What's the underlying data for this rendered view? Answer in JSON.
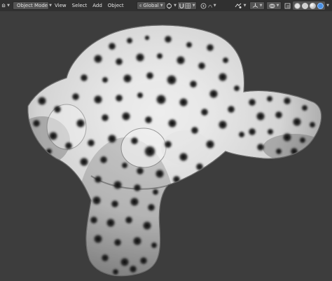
{
  "header": {
    "editor_type_icon": "3d-viewport-icon",
    "mode": {
      "icon": "object-mode-icon",
      "label": "Object Mode"
    },
    "menu": [
      {
        "label": "View"
      },
      {
        "label": "Select"
      },
      {
        "label": "Add"
      },
      {
        "label": "Object"
      }
    ],
    "transform_orientation": {
      "icon": "orientation-icon",
      "label": "Global"
    },
    "pivot_icon": "pivot-point-icon",
    "snap_icon": "magnet-icon",
    "snap_target_icon": "snap-increment-icon",
    "proportional_icon": "proportional-edit-icon",
    "proportional_falloff_icon": "falloff-curve-icon",
    "visibility_icon": "visibility-icon",
    "gizmo_icon": "gizmo-icon",
    "overlay_icon": "overlay-icon",
    "xray_icon": "xray-icon",
    "shading_modes": [
      {
        "name": "wireframe-shading",
        "color": "#e0e0e0"
      },
      {
        "name": "solid-shading",
        "color": "#cfcfcf"
      },
      {
        "name": "material-preview-shading",
        "color": "#b8b8b8"
      },
      {
        "name": "rendered-shading",
        "color": "#4a90e2",
        "active": true
      }
    ]
  },
  "viewport": {
    "background": "#3d3d3d",
    "object": "suzanne-monkey-head",
    "material": "spotted-white-fur"
  }
}
